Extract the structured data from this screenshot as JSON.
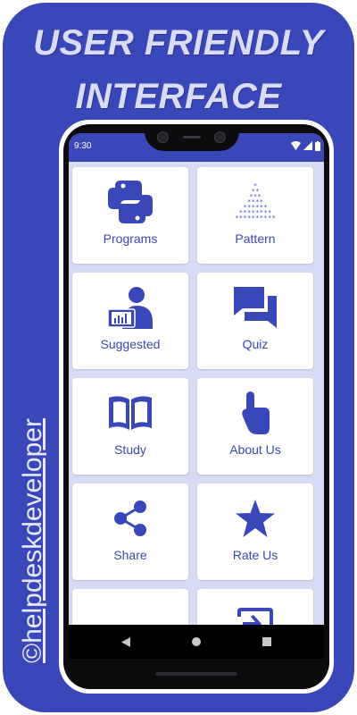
{
  "headline": {
    "line1": "USER FRIENDLY",
    "line2": "INTERFACE"
  },
  "watermark": "©helpdeskdeveloper",
  "phone": {
    "status_bar": {
      "time": "9:30",
      "icons": [
        "wifi-icon",
        "signal-icon",
        "battery-icon"
      ]
    },
    "accent_color": "#3a47b8",
    "screen_background": "#d6daf3",
    "menu": [
      {
        "label": "Programs",
        "icon": "python-logo-icon"
      },
      {
        "label": "Pattern",
        "icon": "star-pyramid-icon"
      },
      {
        "label": "Suggested",
        "icon": "user-at-screen-icon"
      },
      {
        "label": "Quiz",
        "icon": "chat-bubbles-icon"
      },
      {
        "label": "Study",
        "icon": "open-book-icon"
      },
      {
        "label": "About Us",
        "icon": "tap-hand-icon"
      },
      {
        "label": "Share",
        "icon": "share-icon"
      },
      {
        "label": "Rate Us",
        "icon": "star-icon"
      },
      {
        "label": "",
        "icon": "more-dots-icon"
      },
      {
        "label": "",
        "icon": "exit-icon"
      }
    ],
    "nav_bar": [
      "back-icon",
      "home-icon",
      "recents-icon"
    ]
  }
}
